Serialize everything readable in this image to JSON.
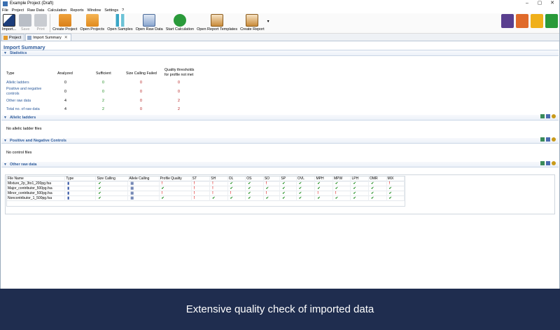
{
  "app": {
    "title": "Example Project (Draft)"
  },
  "menu": [
    "File",
    "Project",
    "Raw Data",
    "Calculation",
    "Reports",
    "Window",
    "Settings",
    "?"
  ],
  "toolbar": {
    "import": "Import...",
    "save": "Save",
    "print": "Print",
    "create_project": "Create Project",
    "open_projects": "Open Projects",
    "open_samples": "Open Samples",
    "open_raw_data": "Open Raw Data",
    "start_calculation": "Start Calculation",
    "open_report_templates": "Open Report Templates",
    "create_report": "Create Report"
  },
  "tabs": [
    {
      "label": "Project"
    },
    {
      "label": "Import Summary"
    }
  ],
  "page_title": "Import Summary",
  "statistics": {
    "heading": "Statistics",
    "col_type": "Type",
    "col_analyzed": "Analyzed",
    "col_sufficient": "Sufficient",
    "col_size_failed": "Size Calling Failed",
    "col_quality_1": "Quality thresholds",
    "col_quality_2": "for profile not met",
    "rows": [
      {
        "type": "Allelic ladders",
        "analyzed": "0",
        "sufficient": "0",
        "failed": "0",
        "quality": "0"
      },
      {
        "type_1": "Positive and negative",
        "type_2": "controls",
        "analyzed": "0",
        "sufficient": "0",
        "failed": "0",
        "quality": "0"
      },
      {
        "type": "Other raw data",
        "analyzed": "4",
        "sufficient": "2",
        "failed": "0",
        "quality": "2"
      },
      {
        "type": "Total no. of raw data",
        "analyzed": "4",
        "sufficient": "2",
        "failed": "0",
        "quality": "2"
      }
    ]
  },
  "allelic_ladders": {
    "heading": "Allelic ladders",
    "message": "No allelic ladder files"
  },
  "controls": {
    "heading": "Positive and Negative Controls",
    "message": "No control files"
  },
  "other_raw_data": {
    "heading": "Other raw data",
    "columns": [
      "File Name",
      "Type",
      "Size Calling",
      "Allele Calling",
      "Profile Quality",
      "ST",
      "SH",
      "OL",
      "OS",
      "SO",
      "SP",
      "OVL",
      "MPH",
      "MPW",
      "LPH",
      "OMR",
      "MIX"
    ],
    "rows": [
      {
        "file": "Mixture_2p_3to1_200pg.fsa",
        "marks": [
          "tp",
          "ck",
          "ac",
          "ex",
          "ex",
          "ex",
          "ck",
          "ck",
          "ex",
          "ck",
          "ck",
          "ck",
          "ck",
          "ck",
          "ck",
          "ex"
        ]
      },
      {
        "file": "Major_contributor_500pg.fsa",
        "marks": [
          "tp",
          "ck",
          "ac",
          "ck",
          "ex",
          "ex",
          "ck",
          "ck",
          "ck",
          "ck",
          "ck",
          "ck",
          "ck",
          "ck",
          "ck",
          "ck"
        ]
      },
      {
        "file": "Minor_contributor_500pg.fsa",
        "marks": [
          "tp",
          "ck",
          "ac",
          "ex",
          "ex",
          "ex",
          "ex",
          "ck",
          "ex",
          "ck",
          "ck",
          "ex",
          "ex",
          "ck",
          "ck",
          "ck"
        ]
      },
      {
        "file": "Noncontributor_1_500pg.fsa",
        "marks": [
          "tp",
          "ck",
          "ac",
          "ck",
          "ex",
          "ck",
          "ck",
          "ck",
          "ck",
          "ck",
          "ck",
          "ck",
          "ck",
          "ck",
          "ck",
          "ck"
        ]
      }
    ]
  },
  "banner": {
    "text": "Extensive quality check of imported data"
  },
  "colors": {
    "accent": "#2c5a9b",
    "banner": "#1f2d4f",
    "ok": "#1b8a1b",
    "fail": "#b01515"
  }
}
